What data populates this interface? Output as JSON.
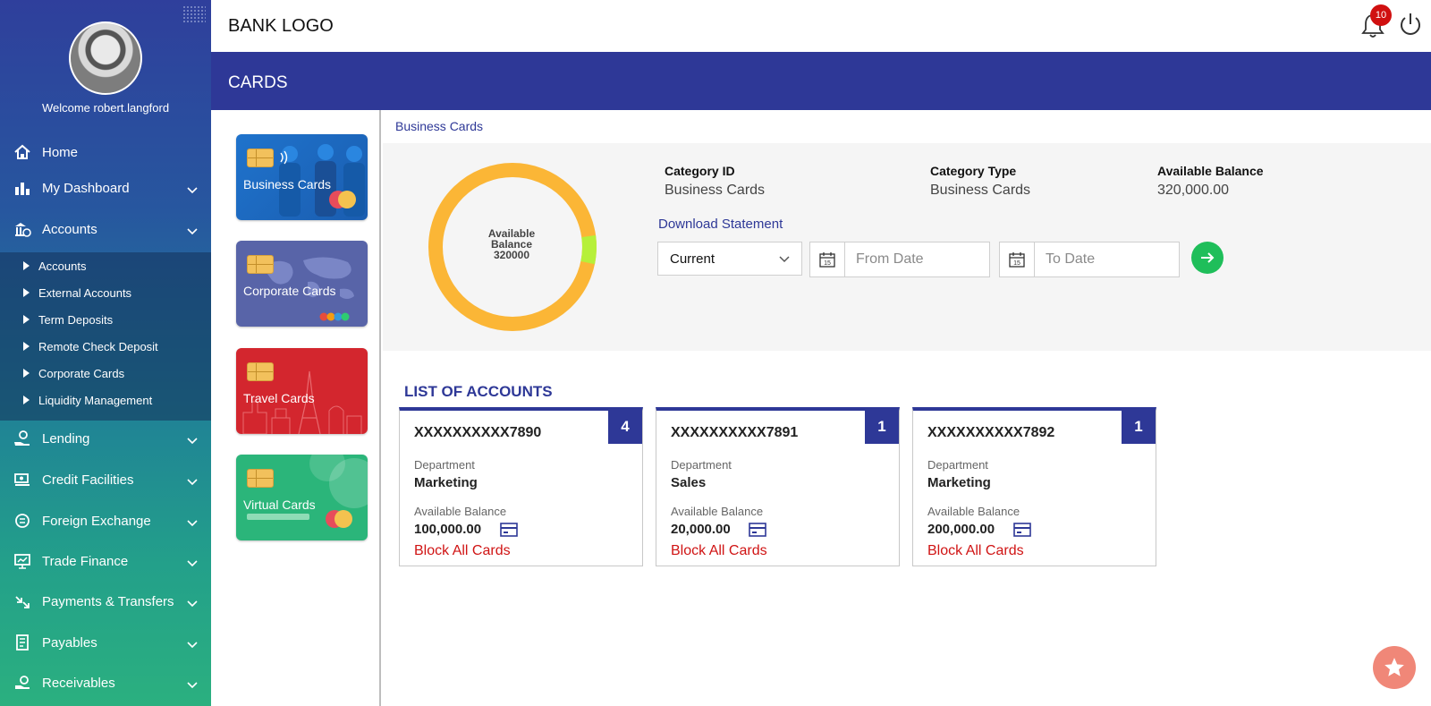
{
  "user": {
    "welcome": "Welcome robert.langford"
  },
  "sidebar": {
    "items": [
      {
        "label": "Home",
        "icon": "home-icon"
      },
      {
        "label": "My Dashboard",
        "icon": "bar-chart-icon"
      },
      {
        "label": "Accounts",
        "icon": "accounts-icon"
      },
      {
        "label": "Lending",
        "icon": "lending-icon"
      },
      {
        "label": "Credit Facilities",
        "icon": "credit-facilities-icon"
      },
      {
        "label": "Foreign Exchange",
        "icon": "foreign-exchange-icon"
      },
      {
        "label": "Trade Finance",
        "icon": "trade-finance-icon"
      },
      {
        "label": "Payments & Transfers",
        "icon": "payments-icon"
      },
      {
        "label": "Payables",
        "icon": "payables-icon"
      },
      {
        "label": "Receivables",
        "icon": "receivables-icon"
      }
    ],
    "accounts_submenu": [
      "Accounts",
      "External Accounts",
      "Term Deposits",
      "Remote Check Deposit",
      "Corporate Cards",
      "Liquidity Management"
    ]
  },
  "header": {
    "logo": "BANK LOGO",
    "notification_count": "10"
  },
  "page": {
    "title": "CARDS",
    "breadcrumb": "Business Cards"
  },
  "card_types": [
    {
      "label": "Business Cards",
      "color": "#1e6fc4"
    },
    {
      "label": "Corporate Cards",
      "color": "#5864a8"
    },
    {
      "label": "Travel Cards",
      "color": "#d3262e"
    },
    {
      "label": "Virtual Cards",
      "color": "#2bb57a"
    }
  ],
  "summary": {
    "donut_label": "Available Balance",
    "donut_value": "320000",
    "donut_colors": {
      "main": "#fbb636",
      "accent": "#b6f03a"
    },
    "category_id_label": "Category ID",
    "category_id": "Business Cards",
    "category_type_label": "Category Type",
    "category_type": "Business Cards",
    "balance_label": "Available Balance",
    "balance": "320,000.00",
    "download_statement": "Download Statement",
    "period_selected": "Current",
    "from_placeholder": "From Date",
    "to_placeholder": "To Date",
    "calendar_day": "15"
  },
  "accounts": {
    "title": "LIST OF ACCOUNTS",
    "department_label": "Department",
    "balance_label": "Available Balance",
    "block_label": "Block All Cards",
    "items": [
      {
        "number": "XXXXXXXXXX7890",
        "count": "4",
        "department": "Marketing",
        "balance": "100,000.00"
      },
      {
        "number": "XXXXXXXXXX7891",
        "count": "1",
        "department": "Sales",
        "balance": "20,000.00"
      },
      {
        "number": "XXXXXXXXXX7892",
        "count": "1",
        "department": "Marketing",
        "balance": "200,000.00"
      }
    ]
  },
  "colors": {
    "primary": "#2e3897",
    "danger": "#d01414",
    "go": "#1fbe5a"
  }
}
